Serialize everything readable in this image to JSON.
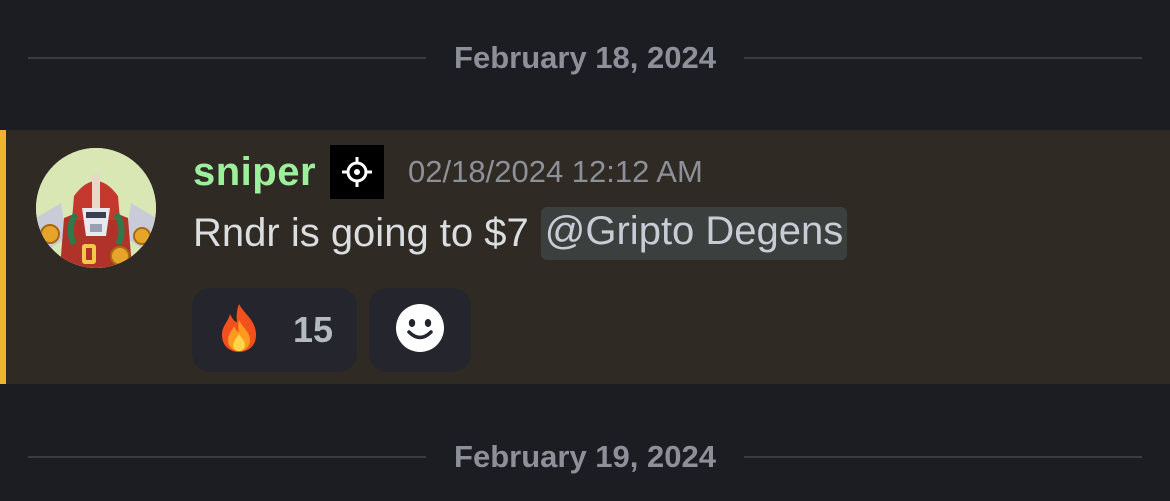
{
  "dividers": {
    "top_date": "February 18, 2024",
    "bottom_date": "February 19, 2024"
  },
  "message": {
    "username": "sniper",
    "username_color": "#9df09b",
    "badge_icon": "crosshair-icon",
    "timestamp": "02/18/2024 12:12 AM",
    "text": "Rndr is going to $7",
    "mention": "@Gripto Degens",
    "highlight_color": "#f0b232",
    "avatar": "robot-avatar"
  },
  "reactions": [
    {
      "emoji_icon": "fire-icon",
      "count": "15"
    },
    {
      "emoji_icon": "add-reaction-smiley-icon"
    }
  ]
}
